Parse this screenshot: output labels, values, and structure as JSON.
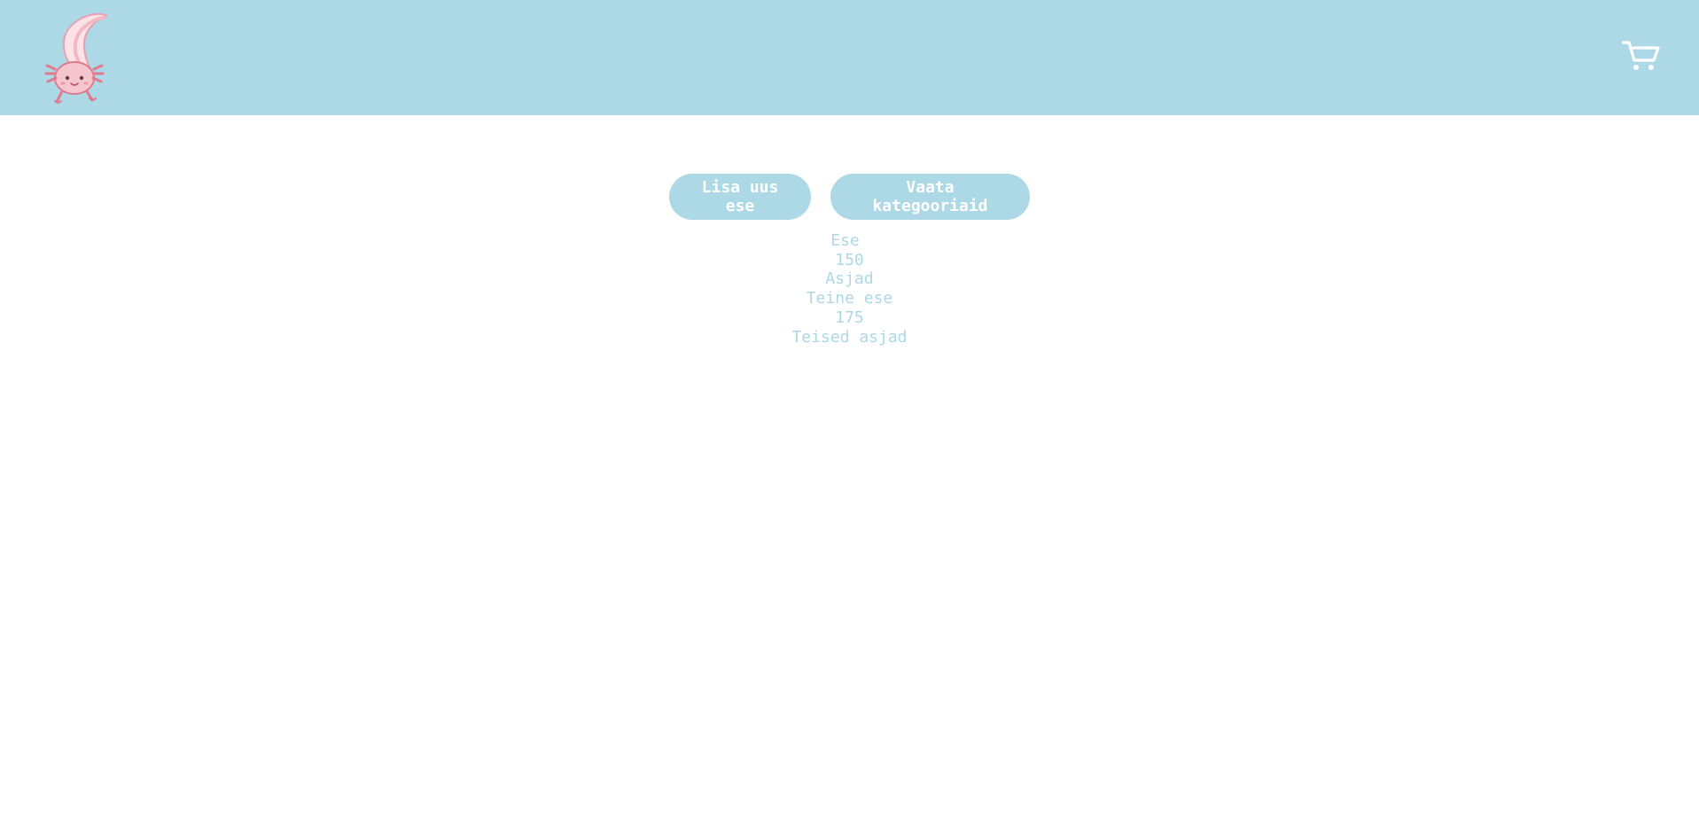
{
  "header": {
    "logo_icon": "axolotl-logo-icon",
    "cart_icon": "shopping-cart-icon",
    "background_color": "#add8e6"
  },
  "actions": {
    "add_item_label": "Lisa uus ese",
    "view_categories_label": "Vaata kategooriaid"
  },
  "items": [
    {
      "name": "Ese",
      "price": "150",
      "category": "Asjad"
    },
    {
      "name": "Teine ese",
      "price": "175",
      "category": "Teised asjad"
    }
  ],
  "colors": {
    "accent": "#add8e6",
    "button_text": "#ffffff",
    "axolotl_pink": "#f4b6c2",
    "axolotl_outline": "#e07a8f"
  }
}
